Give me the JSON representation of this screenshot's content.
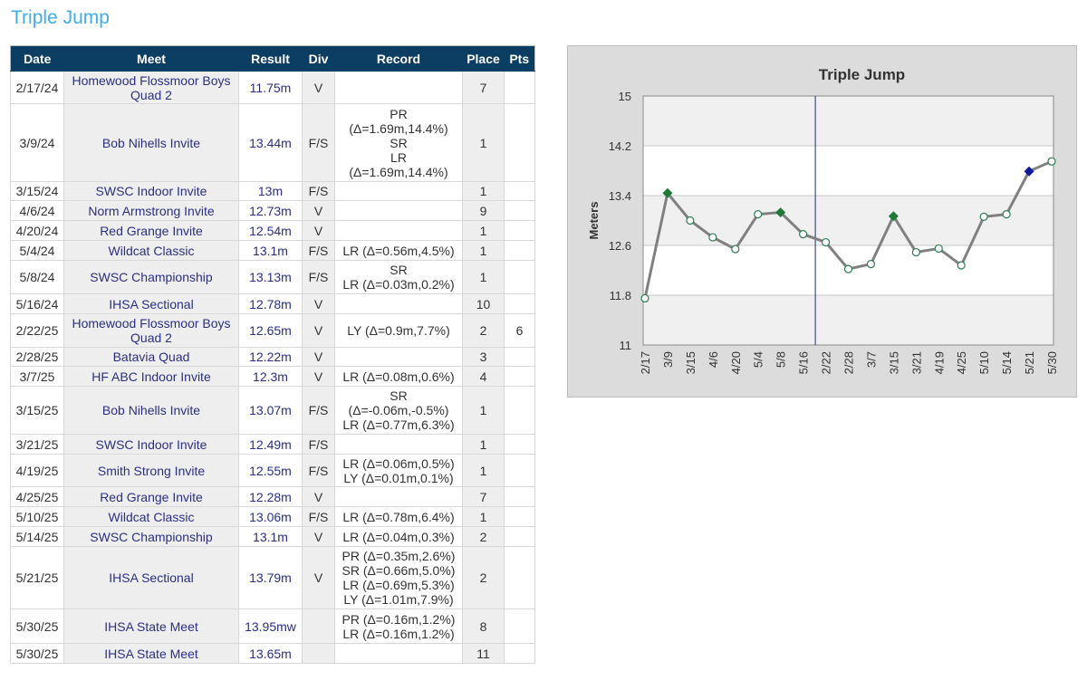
{
  "page": {
    "title": "Triple Jump"
  },
  "table": {
    "headers": [
      "Date",
      "Meet",
      "Result",
      "Div",
      "Record",
      "Place",
      "Pts"
    ],
    "rows": [
      {
        "date": "2/17/24",
        "meet": "Homewood Flossmoor Boys Quad 2",
        "result": "11.75m",
        "div": "V",
        "record": [],
        "place": "7",
        "pts": ""
      },
      {
        "date": "3/9/24",
        "meet": "Bob Nihells Invite",
        "result": "13.44m",
        "div": "F/S",
        "record": [
          "PR",
          "(Δ=1.69m,14.4%)",
          "SR",
          "LR",
          "(Δ=1.69m,14.4%)"
        ],
        "place": "1",
        "pts": ""
      },
      {
        "date": "3/15/24",
        "meet": "SWSC Indoor Invite",
        "result": "13m",
        "div": "F/S",
        "record": [],
        "place": "1",
        "pts": ""
      },
      {
        "date": "4/6/24",
        "meet": "Norm Armstrong Invite",
        "result": "12.73m",
        "div": "V",
        "record": [],
        "place": "9",
        "pts": ""
      },
      {
        "date": "4/20/24",
        "meet": "Red Grange Invite",
        "result": "12.54m",
        "div": "V",
        "record": [],
        "place": "1",
        "pts": ""
      },
      {
        "date": "5/4/24",
        "meet": "Wildcat Classic",
        "result": "13.1m",
        "div": "F/S",
        "record": [
          "LR (Δ=0.56m,4.5%)"
        ],
        "place": "1",
        "pts": ""
      },
      {
        "date": "5/8/24",
        "meet": "SWSC Championship",
        "result": "13.13m",
        "div": "F/S",
        "record": [
          "SR",
          "LR (Δ=0.03m,0.2%)"
        ],
        "place": "1",
        "pts": ""
      },
      {
        "date": "5/16/24",
        "meet": "IHSA Sectional",
        "result": "12.78m",
        "div": "V",
        "record": [],
        "place": "10",
        "pts": ""
      },
      {
        "date": "2/22/25",
        "meet": "Homewood Flossmoor Boys Quad 2",
        "result": "12.65m",
        "div": "V",
        "record": [
          "LY (Δ=0.9m,7.7%)"
        ],
        "place": "2",
        "pts": "6"
      },
      {
        "date": "2/28/25",
        "meet": "Batavia Quad",
        "result": "12.22m",
        "div": "V",
        "record": [],
        "place": "3",
        "pts": ""
      },
      {
        "date": "3/7/25",
        "meet": "HF ABC Indoor Invite",
        "result": "12.3m",
        "div": "V",
        "record": [
          "LR (Δ=0.08m,0.6%)"
        ],
        "place": "4",
        "pts": ""
      },
      {
        "date": "3/15/25",
        "meet": "Bob Nihells Invite",
        "result": "13.07m",
        "div": "F/S",
        "record": [
          "SR",
          "(Δ=-0.06m,-0.5%)",
          "LR (Δ=0.77m,6.3%)"
        ],
        "place": "1",
        "pts": ""
      },
      {
        "date": "3/21/25",
        "meet": "SWSC Indoor Invite",
        "result": "12.49m",
        "div": "F/S",
        "record": [],
        "place": "1",
        "pts": ""
      },
      {
        "date": "4/19/25",
        "meet": "Smith Strong Invite",
        "result": "12.55m",
        "div": "F/S",
        "record": [
          "LR (Δ=0.06m,0.5%)",
          "LY (Δ=0.01m,0.1%)"
        ],
        "place": "1",
        "pts": ""
      },
      {
        "date": "4/25/25",
        "meet": "Red Grange Invite",
        "result": "12.28m",
        "div": "V",
        "record": [],
        "place": "7",
        "pts": ""
      },
      {
        "date": "5/10/25",
        "meet": "Wildcat Classic",
        "result": "13.06m",
        "div": "F/S",
        "record": [
          "LR (Δ=0.78m,6.4%)"
        ],
        "place": "1",
        "pts": ""
      },
      {
        "date": "5/14/25",
        "meet": "SWSC Championship",
        "result": "13.1m",
        "div": "V",
        "record": [
          "LR (Δ=0.04m,0.3%)"
        ],
        "place": "2",
        "pts": ""
      },
      {
        "date": "5/21/25",
        "meet": "IHSA Sectional",
        "result": "13.79m",
        "div": "V",
        "record": [
          "PR (Δ=0.35m,2.6%)",
          "SR (Δ=0.66m,5.0%)",
          "LR (Δ=0.69m,5.3%)",
          "LY (Δ=1.01m,7.9%)"
        ],
        "place": "2",
        "pts": ""
      },
      {
        "date": "5/30/25",
        "meet": "IHSA State Meet",
        "result": "13.95mw",
        "div": "",
        "record": [
          "PR (Δ=0.16m,1.2%)",
          "LR (Δ=0.16m,1.2%)"
        ],
        "place": "8",
        "pts": ""
      },
      {
        "date": "5/30/25",
        "meet": "IHSA State Meet",
        "result": "13.65m",
        "div": "",
        "record": [],
        "place": "11",
        "pts": ""
      }
    ]
  },
  "chart_data": {
    "type": "line",
    "title": "Triple Jump",
    "ylabel": "Meters",
    "xlabel": "",
    "ylim": [
      11,
      15
    ],
    "yticks": [
      "11",
      "11.8",
      "12.6",
      "13.4",
      "14.2",
      "15"
    ],
    "grid": true,
    "season_divider_after": "5/16",
    "colors": {
      "line": "#808080",
      "marker_default": "#ffffff",
      "marker_stroke_default": "#2e7d50",
      "marker_green": "#1f7a3a",
      "marker_blue": "#0a1a9a",
      "divider": "#1c2b6e",
      "plot_band": "#f0f0f0"
    },
    "categories": [
      "2/17",
      "3/9",
      "3/15",
      "4/6",
      "4/20",
      "5/4",
      "5/8",
      "5/16",
      "2/22",
      "2/28",
      "3/7",
      "3/15",
      "3/21",
      "4/19",
      "4/25",
      "5/10",
      "5/14",
      "5/21",
      "5/30"
    ],
    "series": [
      {
        "values": [
          11.75,
          13.44,
          13.0,
          12.73,
          12.54,
          13.1,
          13.13,
          12.78,
          12.65,
          12.22,
          12.3,
          13.07,
          12.49,
          12.55,
          12.28,
          13.06,
          13.1,
          13.79,
          13.95
        ],
        "markers": [
          "circle",
          "diamond-green",
          "circle",
          "circle",
          "circle",
          "circle",
          "diamond-green",
          "circle",
          "circle",
          "circle",
          "circle",
          "diamond-green",
          "circle",
          "circle",
          "circle",
          "circle",
          "circle",
          "diamond-blue",
          "circle"
        ]
      }
    ]
  }
}
